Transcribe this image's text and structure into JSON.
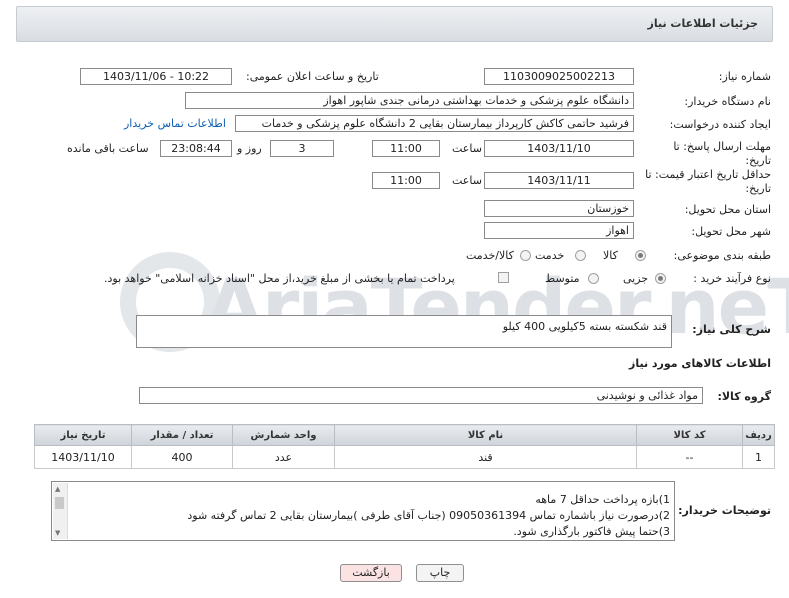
{
  "header": {
    "title": "جزئیات اطلاعات نیاز"
  },
  "fields": {
    "need_number_label": "شماره نیاز:",
    "need_number": "1103009025002213",
    "announce_label": "تاریخ و ساعت اعلان عمومی:",
    "announce_value": "1403/11/06 - 10:22",
    "buyer_org_label": "نام دستگاه خریدار:",
    "buyer_org": "دانشگاه علوم پزشکی و خدمات بهداشتی درمانی جندی شاپور اهواز",
    "requester_label": "ایجاد کننده درخواست:",
    "requester": "فرشید حاتمی کاکش کارپرداز بیمارستان بقایی 2 دانشگاه علوم پزشکی و خدمات",
    "buyer_contact_link": "اطلاعات تماس خریدار",
    "reply_deadline_label": "مهلت ارسال پاسخ: تا تاریخ:",
    "reply_date": "1403/11/10",
    "time_label": "ساعت",
    "reply_time": "11:00",
    "days_value": "3",
    "days_label": "روز و",
    "remaining_time": "23:08:44",
    "remaining_label": "ساعت باقی مانده",
    "price_validity_label": "حداقل تاریخ اعتبار قیمت: تا تاریخ:",
    "price_date": "1403/11/11",
    "price_time": "11:00",
    "province_label": "استان محل تحویل:",
    "province": "خوزستان",
    "city_label": "شهر محل تحویل:",
    "city": "اهواز",
    "category_label": "طبقه بندی موضوعی:",
    "category_options": [
      "کالا",
      "خدمت",
      "کالا/خدمت"
    ],
    "process_label": "نوع فرآیند خرید :",
    "process_options": [
      "جزیی",
      "متوسط"
    ],
    "payment_note": "پرداخت تمام یا بخشی از مبلغ خرید،از محل \"اسناد خزانه اسلامی\" خواهد بود.",
    "summary_label": "شرح کلی نیاز:",
    "summary": "قند شکسته  بسته 5کیلویی 400 کیلو",
    "goods_info_title": "اطلاعات کالاهای مورد نیاز",
    "goods_group_label": "گروه کالا:",
    "goods_group": "مواد غذائی و نوشیدنی"
  },
  "table": {
    "headers": [
      "ردیف",
      "کد کالا",
      "نام کالا",
      "واحد شمارش",
      "تعداد / مقدار",
      "تاریخ نیاز"
    ],
    "rows": [
      [
        "1",
        "--",
        "قند",
        "عدد",
        "400",
        "1403/11/10"
      ]
    ]
  },
  "buyer_notes": {
    "label": "توضیحات خریدار:",
    "lines": [
      "1)بازه پرداخت حداقل 7 ماهه",
      "2)درصورت نیاز باشماره تماس 09050361394 (جناب آقای طرفی )بیمارستان بقایی 2 تماس گرفته شود",
      "3)حتما پیش فاکتور بارگذاری شود."
    ]
  },
  "buttons": {
    "print": "چاپ",
    "back": "بازگشت"
  },
  "watermark": "AriaTender.neT",
  "colors": {
    "link": "#0b5fb3",
    "back_button_bg": "#fbe3e3",
    "print_button_bg": "#f4f4f4"
  }
}
